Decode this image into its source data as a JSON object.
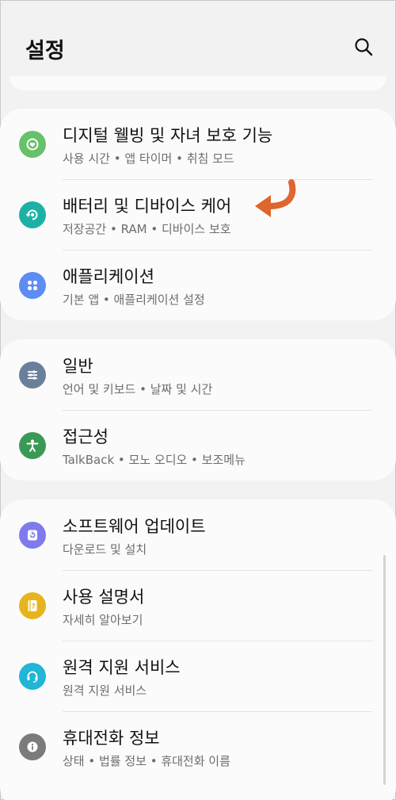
{
  "header": {
    "title": "설정"
  },
  "colors": {
    "wellbeing": "#67c06a",
    "device_care": "#1bb2a5",
    "apps": "#5d8cf3",
    "general": "#6a7f99",
    "accessibility": "#3a9a55",
    "software_update": "#7f7bed",
    "manual": "#e6b51e",
    "remote_support": "#22b5d6",
    "phone_info": "#7b7b7b",
    "highlight_arrow": "#e0652f"
  },
  "groups": [
    {
      "items": [
        {
          "title": "디지털 웰빙 및 자녀 보호 기능",
          "subtitle": "사용 시간 • 앱 타이머 • 취침 모드",
          "icon": "wellbeing-icon"
        },
        {
          "title": "배터리 및 디바이스 케어",
          "subtitle": "저장공간 • RAM • 디바이스 보호",
          "icon": "device-care-icon"
        },
        {
          "title": "애플리케이션",
          "subtitle": "기본 앱 • 애플리케이션 설정",
          "icon": "apps-icon"
        }
      ]
    },
    {
      "items": [
        {
          "title": "일반",
          "subtitle": "언어 및 키보드 • 날짜 및 시간",
          "icon": "sliders-icon"
        },
        {
          "title": "접근성",
          "subtitle": "TalkBack • 모노 오디오 • 보조메뉴",
          "icon": "accessibility-icon"
        }
      ]
    },
    {
      "items": [
        {
          "title": "소프트웨어 업데이트",
          "subtitle": "다운로드 및 설치",
          "icon": "update-icon"
        },
        {
          "title": "사용 설명서",
          "subtitle": "자세히 알아보기",
          "icon": "manual-icon"
        },
        {
          "title": "원격 지원 서비스",
          "subtitle": "원격 지원 서비스",
          "icon": "headset-icon"
        },
        {
          "title": "휴대전화 정보",
          "subtitle": "상태 • 법률 정보 • 휴대전화 이름",
          "icon": "info-icon"
        }
      ]
    }
  ]
}
